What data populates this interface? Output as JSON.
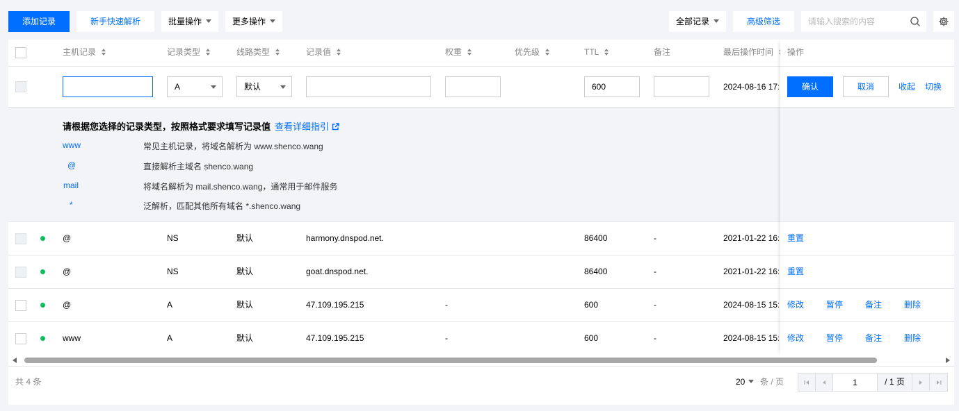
{
  "toolbar": {
    "add_record": "添加记录",
    "quick_setup": "新手快速解析",
    "batch_ops": "批量操作",
    "more_ops": "更多操作",
    "filter_all": "全部记录",
    "advanced_filter": "高级筛选",
    "search_placeholder": "请输入搜索的内容"
  },
  "columns": {
    "host": "主机记录",
    "type": "记录类型",
    "line": "线路类型",
    "value": "记录值",
    "weight": "权重",
    "priority": "优先级",
    "ttl": "TTL",
    "remark": "备注",
    "last_op": "最后操作时间",
    "ops": "操作"
  },
  "edit_row": {
    "host": "",
    "type": "A",
    "line": "默认",
    "value": "",
    "weight": "",
    "ttl": "600",
    "remark": "",
    "time": "2024-08-16 17:",
    "confirm": "确认",
    "cancel": "取消",
    "collapse": "收起",
    "switch": "切换"
  },
  "guide": {
    "title": "请根据您选择的记录类型，按照格式要求填写记录值",
    "link": "查看详细指引",
    "items": [
      {
        "key": "www",
        "desc": "常见主机记录，将域名解析为 www.shenco.wang"
      },
      {
        "key": "@",
        "desc": "直接解析主域名 shenco.wang"
      },
      {
        "key": "mail",
        "desc": "将域名解析为 mail.shenco.wang，通常用于邮件服务"
      },
      {
        "key": "*",
        "desc": "泛解析，匹配其他所有域名 *.shenco.wang"
      }
    ]
  },
  "records": [
    {
      "host": "@",
      "type": "NS",
      "line": "默认",
      "value": "harmony.dnspod.net.",
      "weight": "",
      "ttl": "86400",
      "remark": "-",
      "time": "2021-01-22 16:",
      "actions": [
        "重置"
      ]
    },
    {
      "host": "@",
      "type": "NS",
      "line": "默认",
      "value": "goat.dnspod.net.",
      "weight": "",
      "ttl": "86400",
      "remark": "-",
      "time": "2021-01-22 16:",
      "actions": [
        "重置"
      ]
    },
    {
      "host": "@",
      "type": "A",
      "line": "默认",
      "value": "47.109.195.215",
      "weight": "-",
      "ttl": "600",
      "remark": "-",
      "time": "2024-08-15 15:",
      "actions": [
        "修改",
        "暂停",
        "备注",
        "删除"
      ]
    },
    {
      "host": "www",
      "type": "A",
      "line": "默认",
      "value": "47.109.195.215",
      "weight": "-",
      "ttl": "600",
      "remark": "-",
      "time": "2024-08-15 15:",
      "actions": [
        "修改",
        "暂停",
        "备注",
        "删除"
      ]
    }
  ],
  "footer": {
    "total": "共 4 条",
    "page_size": "20",
    "per_page": "条 / 页",
    "current_page": "1",
    "total_pages": "/ 1 页"
  },
  "colors": {
    "primary": "#006eff",
    "status_enabled": "#0abf5b",
    "background": "#f2f4f7"
  }
}
